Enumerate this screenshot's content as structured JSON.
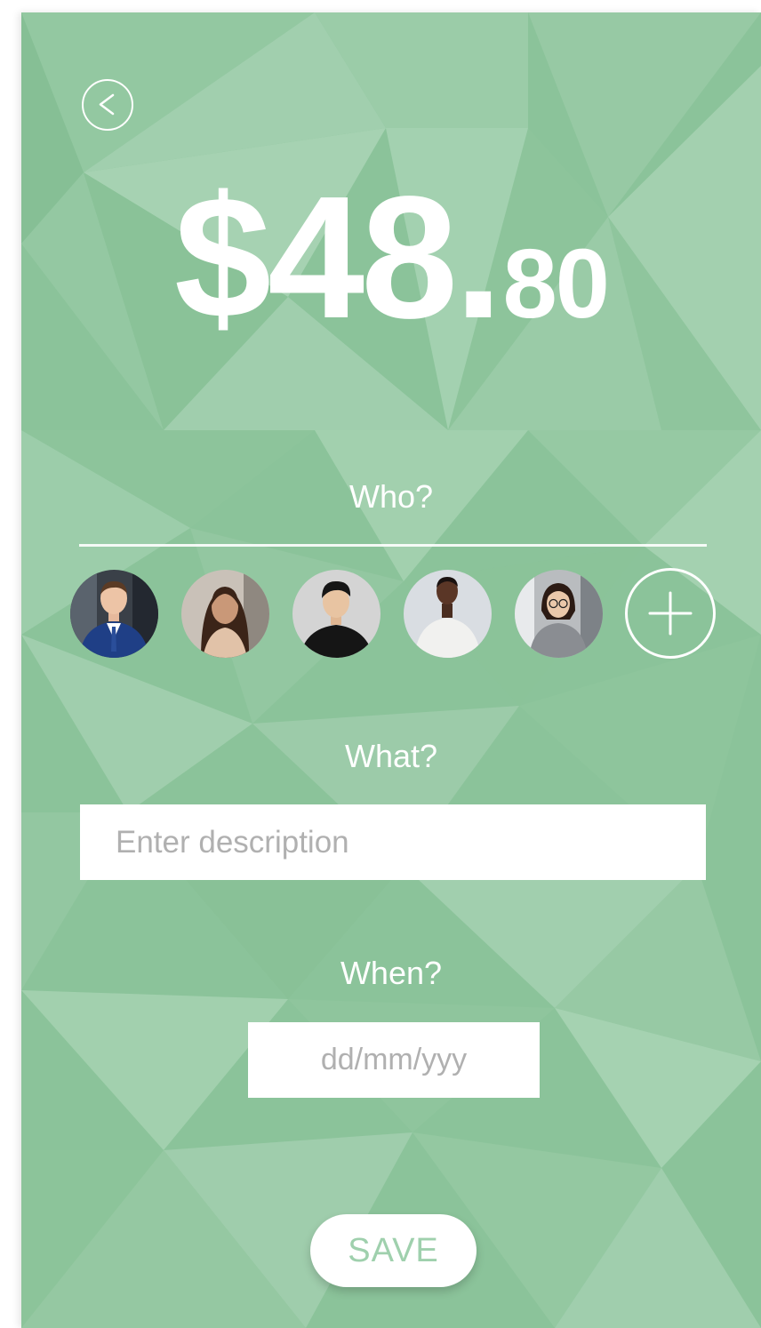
{
  "colors": {
    "background": "#8bc39a",
    "accent_text": "#9fd0ad",
    "foreground": "#ffffff"
  },
  "header": {
    "back_icon": "chevron-left-icon"
  },
  "amount": {
    "dollars": "$48",
    "separator": ".",
    "cents": "80"
  },
  "who": {
    "label": "Who?",
    "people": [
      {
        "name": "person-1",
        "description": "man in blue suit"
      },
      {
        "name": "person-2",
        "description": "woman with long hair"
      },
      {
        "name": "person-3",
        "description": "man in black shirt"
      },
      {
        "name": "person-4",
        "description": "man in white sweater"
      },
      {
        "name": "person-5",
        "description": "woman with glasses"
      }
    ],
    "add_icon": "plus-icon"
  },
  "what": {
    "label": "What?",
    "value": "",
    "placeholder": "Enter description"
  },
  "when": {
    "label": "When?",
    "value": "",
    "placeholder": "dd/mm/yyy"
  },
  "actions": {
    "save_label": "SAVE"
  }
}
